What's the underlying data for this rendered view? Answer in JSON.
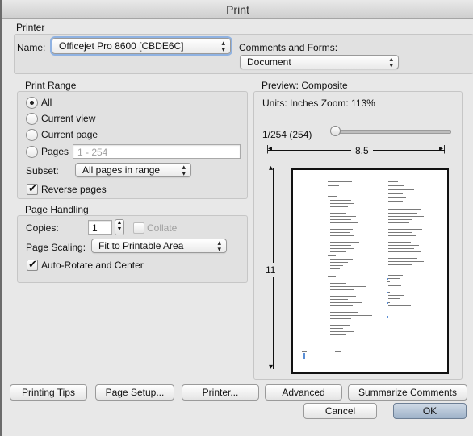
{
  "window": {
    "title": "Print"
  },
  "printer": {
    "section_label": "Printer",
    "name_label": "Name:",
    "name_value": "Officejet Pro 8600 [CBDE6C]",
    "comments_label": "Comments and Forms:",
    "comments_value": "Document"
  },
  "print_range": {
    "section_label": "Print Range",
    "all_label": "All",
    "current_view_label": "Current view",
    "current_page_label": "Current page",
    "pages_label": "Pages",
    "pages_placeholder": "1 - 254",
    "subset_label": "Subset:",
    "subset_value": "All pages in range",
    "reverse_label": "Reverse pages",
    "selected": "All",
    "reverse_checked": true
  },
  "page_handling": {
    "section_label": "Page Handling",
    "copies_label": "Copies:",
    "copies_value": "1",
    "collate_label": "Collate",
    "scaling_label": "Page Scaling:",
    "scaling_value": "Fit to Printable Area",
    "autorotate_label": "Auto-Rotate and Center",
    "autorotate_checked": true
  },
  "preview": {
    "section_label": "Preview: Composite",
    "units_zoom": "Units: Inches Zoom: 113%",
    "page_counter": "1/254 (254)",
    "slider_position": 0.0,
    "width_label": "8.5",
    "height_label": "11"
  },
  "buttons": {
    "printing_tips": "Printing Tips",
    "page_setup": "Page Setup...",
    "printer": "Printer...",
    "advanced": "Advanced",
    "summarize": "Summarize Comments",
    "cancel": "Cancel",
    "ok": "OK"
  },
  "icons": {
    "radio_selected": "radio-dot",
    "check": "checkmark",
    "select_arrows": "updown-arrows"
  },
  "colors": {
    "dialog_bg": "#e8e8e8",
    "default_button": "#a9bcd1"
  }
}
